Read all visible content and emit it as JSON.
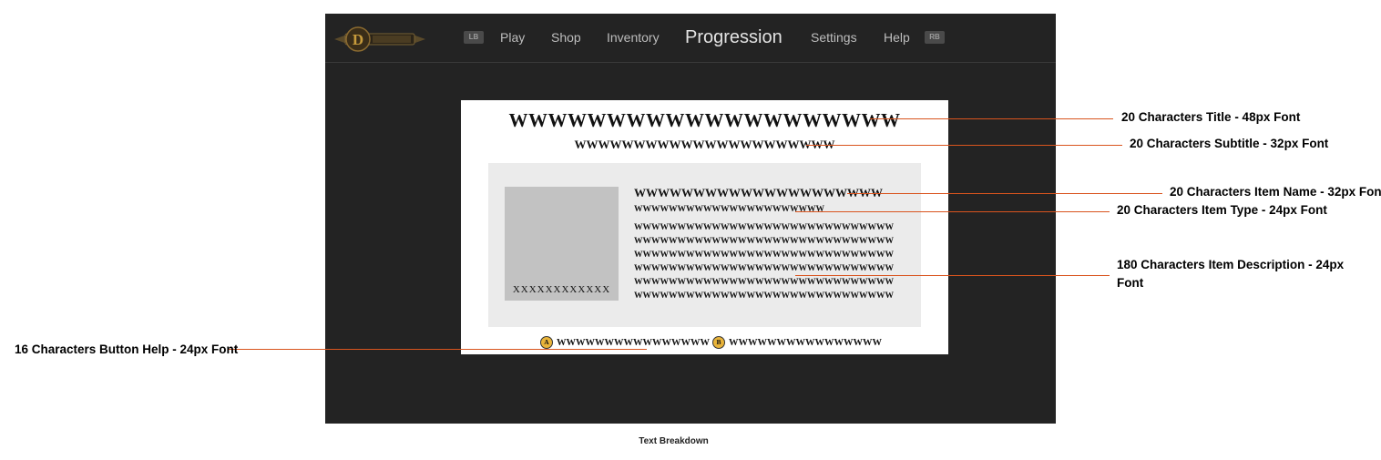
{
  "nav": {
    "logo_icon": "game-logo",
    "left_bumper": "LB",
    "right_bumper": "RB",
    "items": [
      {
        "label": "Play"
      },
      {
        "label": "Shop"
      },
      {
        "label": "Inventory"
      },
      {
        "label": "Progression",
        "active": true
      },
      {
        "label": "Settings"
      },
      {
        "label": "Help"
      }
    ]
  },
  "panel": {
    "title": "WWWWWWWWWWWWWWWWWWWW",
    "subtitle": "WWWWWWWWWWWWWWWWWWWWWW",
    "item": {
      "image_label": "XXXXXXXXXXXX",
      "name": "WWWWWWWWWWWWWWWWWWWWW",
      "type": "WWWWWWWWWWWWWWWWWWWWWW",
      "description": [
        "WWWWWWWWWWWWWWWWWWWWWWWWWWWWWW",
        "WWWWWWWWWWWWWWWWWWWWWWWWWWWWWW",
        "WWWWWWWWWWWWWWWWWWWWWWWWWWWWWW",
        "WWWWWWWWWWWWWWWWWWWWWWWWWWWWWW",
        "WWWWWWWWWWWWWWWWWWWWWWWWWWWWWW",
        "WWWWWWWWWWWWWWWWWWWWWWWWWWWWWW"
      ]
    },
    "button_help": [
      {
        "glyph": "A",
        "label": "WWWWWWWWWWWWWWWW",
        "color": "#e9b43a"
      },
      {
        "glyph": "B",
        "label": "WWWWWWWWWWWWWWWW",
        "color": "#e9b43a"
      }
    ]
  },
  "annotations": {
    "title": "20 Characters  Title - 48px Font",
    "subtitle": "20 Characters Subtitle - 32px Font",
    "item_name": "20 Characters Item Name - 32px Font",
    "item_type": "20 Characters Item Type - 24px Font",
    "item_description_line1": "180 Characters Item Description - 24px",
    "item_description_line2": "Font",
    "button_help": "16 Characters Button Help - 24px Font"
  },
  "caption": "Text Breakdown",
  "colors": {
    "screen_bg": "#232323",
    "leader_line": "#d9541e",
    "item_card_bg": "#ebebeb",
    "item_image_bg": "#c2c2c2"
  }
}
